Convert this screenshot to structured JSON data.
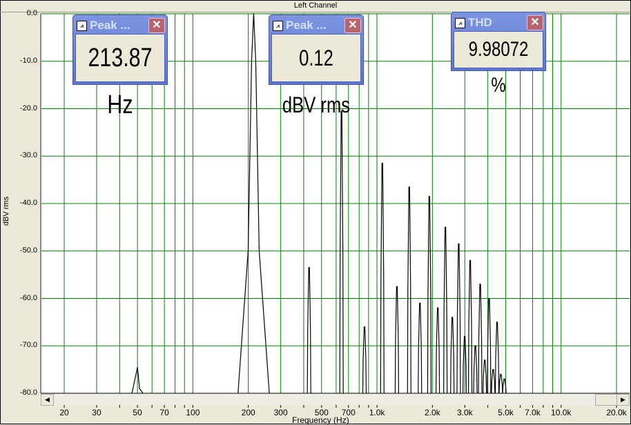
{
  "window": {
    "title": "Left Channel"
  },
  "widgets": [
    {
      "title": "Peak ...",
      "value": "213.87 Hz"
    },
    {
      "title": "Peak ...",
      "value": "0.12 dBV rms"
    },
    {
      "title": "THD",
      "value": "9.98072 %"
    }
  ],
  "chart_data": {
    "type": "line",
    "title": "Left Channel",
    "xlabel": "Frequency (Hz)",
    "ylabel": "dBV rms",
    "xscale": "log",
    "xlim": [
      15,
      23500
    ],
    "ylim": [
      -80,
      0
    ],
    "grid": true,
    "xticks": [
      20,
      30,
      40,
      50,
      60,
      70,
      80,
      90,
      100,
      200,
      300,
      400,
      500,
      600,
      700,
      800,
      900,
      1000,
      2000,
      3000,
      4000,
      5000,
      6000,
      7000,
      8000,
      9000,
      10000,
      20000
    ],
    "xtick_labels": [
      {
        "v": 20,
        "t": "20"
      },
      {
        "v": 30,
        "t": "30"
      },
      {
        "v": 50,
        "t": "50"
      },
      {
        "v": 70,
        "t": "70"
      },
      {
        "v": 100,
        "t": "100"
      },
      {
        "v": 200,
        "t": "200"
      },
      {
        "v": 300,
        "t": "300"
      },
      {
        "v": 500,
        "t": "500"
      },
      {
        "v": 700,
        "t": "700"
      },
      {
        "v": 1000,
        "t": "1.0k"
      },
      {
        "v": 2000,
        "t": "2.0k"
      },
      {
        "v": 3000,
        "t": "3.0k"
      },
      {
        "v": 5000,
        "t": "5.0k"
      },
      {
        "v": 7000,
        "t": "7.0k"
      },
      {
        "v": 10000,
        "t": "10.0k"
      },
      {
        "v": 20000,
        "t": "20.0k"
      }
    ],
    "ytick_labels": [
      "0.0",
      "-10.0",
      "-20.0",
      "-30.0",
      "-40.0",
      "-50.0",
      "-60.0",
      "-70.0",
      "-80.0"
    ],
    "fundamental_hz": 213.87,
    "peaks": [
      {
        "f": 50,
        "db": -74.5
      },
      {
        "f": 213.87,
        "db": 0.12
      },
      {
        "f": 427.7,
        "db": -53.5
      },
      {
        "f": 641.6,
        "db": -20.5
      },
      {
        "f": 855.5,
        "db": -66
      },
      {
        "f": 1069,
        "db": -31.5
      },
      {
        "f": 1283,
        "db": -57.5
      },
      {
        "f": 1497,
        "db": -36.5
      },
      {
        "f": 1711,
        "db": -61
      },
      {
        "f": 1925,
        "db": -38.5
      },
      {
        "f": 2139,
        "db": -62
      },
      {
        "f": 2353,
        "db": -45
      },
      {
        "f": 2566,
        "db": -64
      },
      {
        "f": 2780,
        "db": -48.5
      },
      {
        "f": 2994,
        "db": -68
      },
      {
        "f": 3208,
        "db": -52
      },
      {
        "f": 3422,
        "db": -70
      },
      {
        "f": 3636,
        "db": -57
      },
      {
        "f": 3850,
        "db": -73
      },
      {
        "f": 4064,
        "db": -60
      },
      {
        "f": 4277,
        "db": -75
      },
      {
        "f": 4491,
        "db": -65
      },
      {
        "f": 4705,
        "db": -76
      },
      {
        "f": 4919,
        "db": -77
      }
    ],
    "colors": {
      "grid": "#008000",
      "trace": "#000000"
    }
  }
}
